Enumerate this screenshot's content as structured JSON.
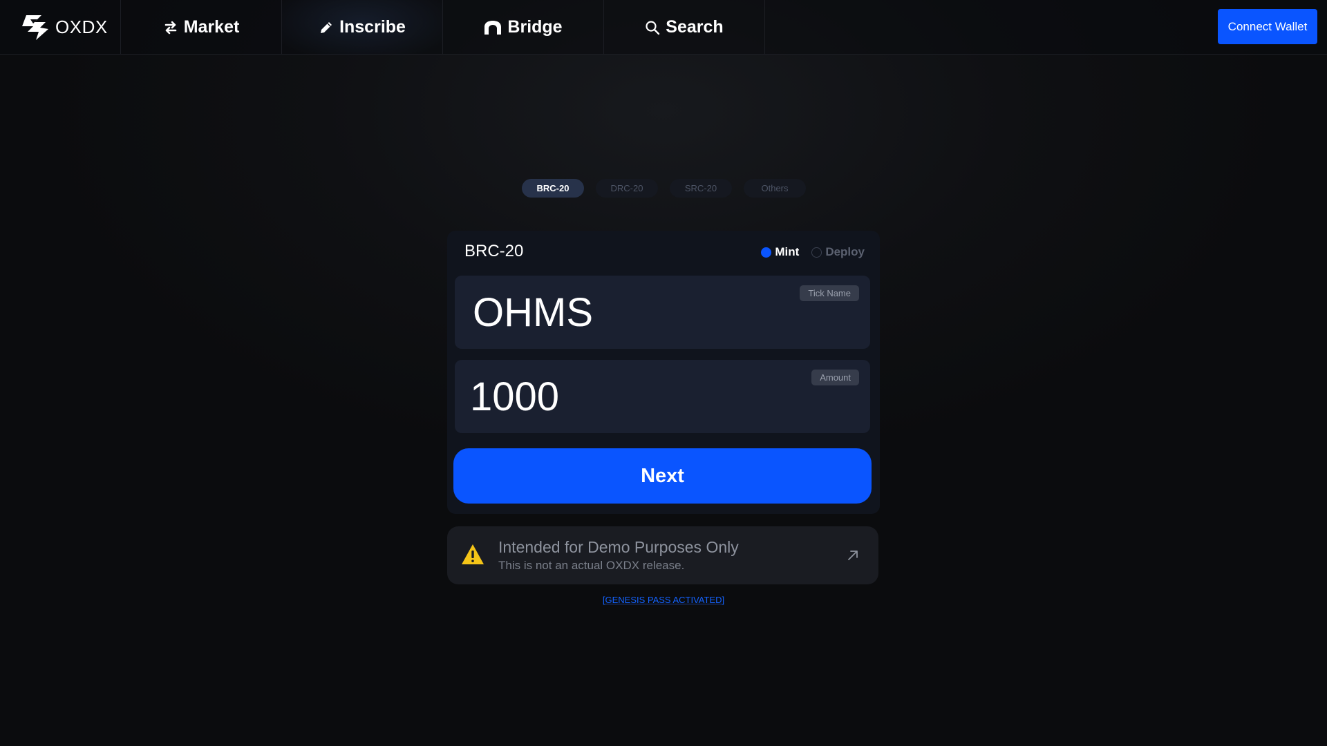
{
  "brand": {
    "name": "OXDX"
  },
  "nav": {
    "items": [
      {
        "label": "Market",
        "icon": "swap-arrows-icon"
      },
      {
        "label": "Inscribe",
        "icon": "pencil-icon"
      },
      {
        "label": "Bridge",
        "icon": "bridge-icon"
      },
      {
        "label": "Search",
        "icon": "search-icon"
      }
    ],
    "active": "Inscribe",
    "connect_label": "Connect Wallet"
  },
  "protocol_tabs": {
    "items": [
      "BRC-20",
      "DRC-20",
      "SRC-20",
      "Others"
    ],
    "active": "BRC-20"
  },
  "card": {
    "title": "BRC-20",
    "mode_options": [
      "Mint",
      "Deploy"
    ],
    "selected_mode": "Mint",
    "tick": {
      "tag": "Tick Name",
      "value": "OHMS"
    },
    "amount": {
      "tag": "Amount",
      "value": "1000"
    },
    "next_label": "Next"
  },
  "notice": {
    "title": "Intended for Demo Purposes Only",
    "subtitle": "This is not an actual OXDX release.",
    "icon": "warning-icon"
  },
  "footer_link": "[GENESIS PASS ACTIVATED]",
  "colors": {
    "accent": "#0a55ff",
    "warning": "#f5c518",
    "background": "#0b0c10",
    "card": "#10141d",
    "field": "#1a2030"
  }
}
